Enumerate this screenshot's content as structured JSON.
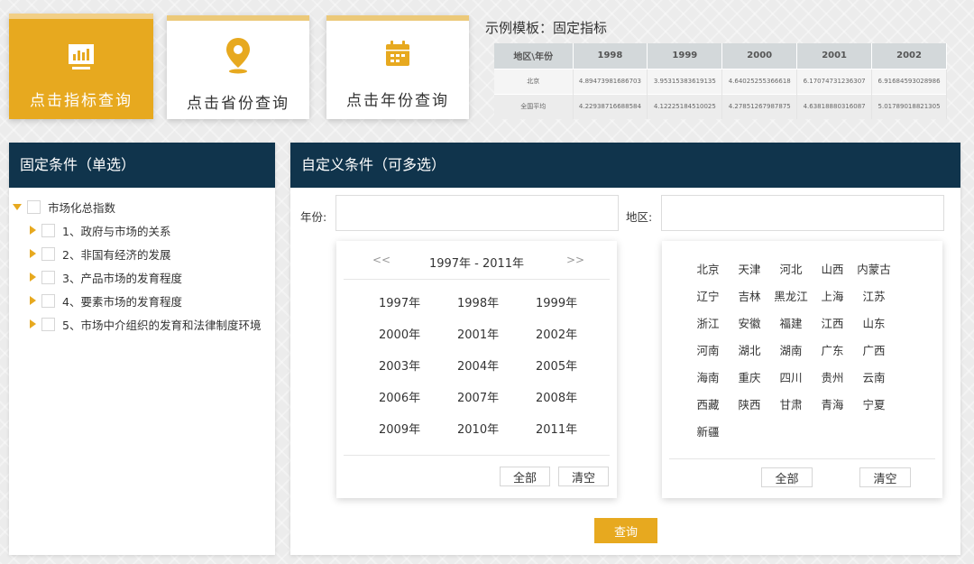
{
  "cards": [
    {
      "label": "点击指标查询",
      "icon": "chart-icon",
      "active": true
    },
    {
      "label": "点击省份查询",
      "icon": "location-pin-icon",
      "active": false
    },
    {
      "label": "点击年份查询",
      "icon": "calendar-icon",
      "active": false
    }
  ],
  "colors": {
    "accent": "#e7a91f",
    "header_bg": "#10344c"
  },
  "sample": {
    "title": "示例模板：固定指标",
    "headers": [
      "地区\\年份",
      "1998",
      "1999",
      "2000",
      "2001",
      "2002"
    ],
    "rows": [
      [
        "北京",
        "4.89473981686703",
        "3.95315383619135",
        "4.64025255366618",
        "6.17074731236307",
        "6.91684593028986"
      ],
      [
        "全国平均",
        "4.22938716688584",
        "4.12225184510025",
        "4.27851267987875",
        "4.63818880316087",
        "5.01789018821305"
      ]
    ]
  },
  "fixed": {
    "title": "固定条件（单选）",
    "root": "市场化总指数",
    "children": [
      "1、政府与市场的关系",
      "2、非国有经济的发展",
      "3、产品市场的发育程度",
      "4、要素市场的发育程度",
      "5、市场中介组织的发育和法律制度环境"
    ]
  },
  "custom": {
    "title": "自定义条件（可多选）",
    "year_label": "年份:",
    "region_label": "地区:",
    "year_picker": {
      "prev": "<<",
      "next": ">>",
      "range": "1997年 - 2011年",
      "years": [
        "1997年",
        "1998年",
        "1999年",
        "2000年",
        "2001年",
        "2002年",
        "2003年",
        "2004年",
        "2005年",
        "2006年",
        "2007年",
        "2008年",
        "2009年",
        "2010年",
        "2011年"
      ],
      "all": "全部",
      "clear": "清空"
    },
    "region_picker": {
      "regions": [
        "北京",
        "天津",
        "河北",
        "山西",
        "内蒙古",
        "辽宁",
        "吉林",
        "黑龙江",
        "上海",
        "江苏",
        "浙江",
        "安徽",
        "福建",
        "江西",
        "山东",
        "河南",
        "湖北",
        "湖南",
        "广东",
        "广西",
        "海南",
        "重庆",
        "四川",
        "贵州",
        "云南",
        "西藏",
        "陕西",
        "甘肃",
        "青海",
        "宁夏",
        "新疆"
      ],
      "all": "全部",
      "clear": "清空"
    },
    "query": "查询"
  }
}
